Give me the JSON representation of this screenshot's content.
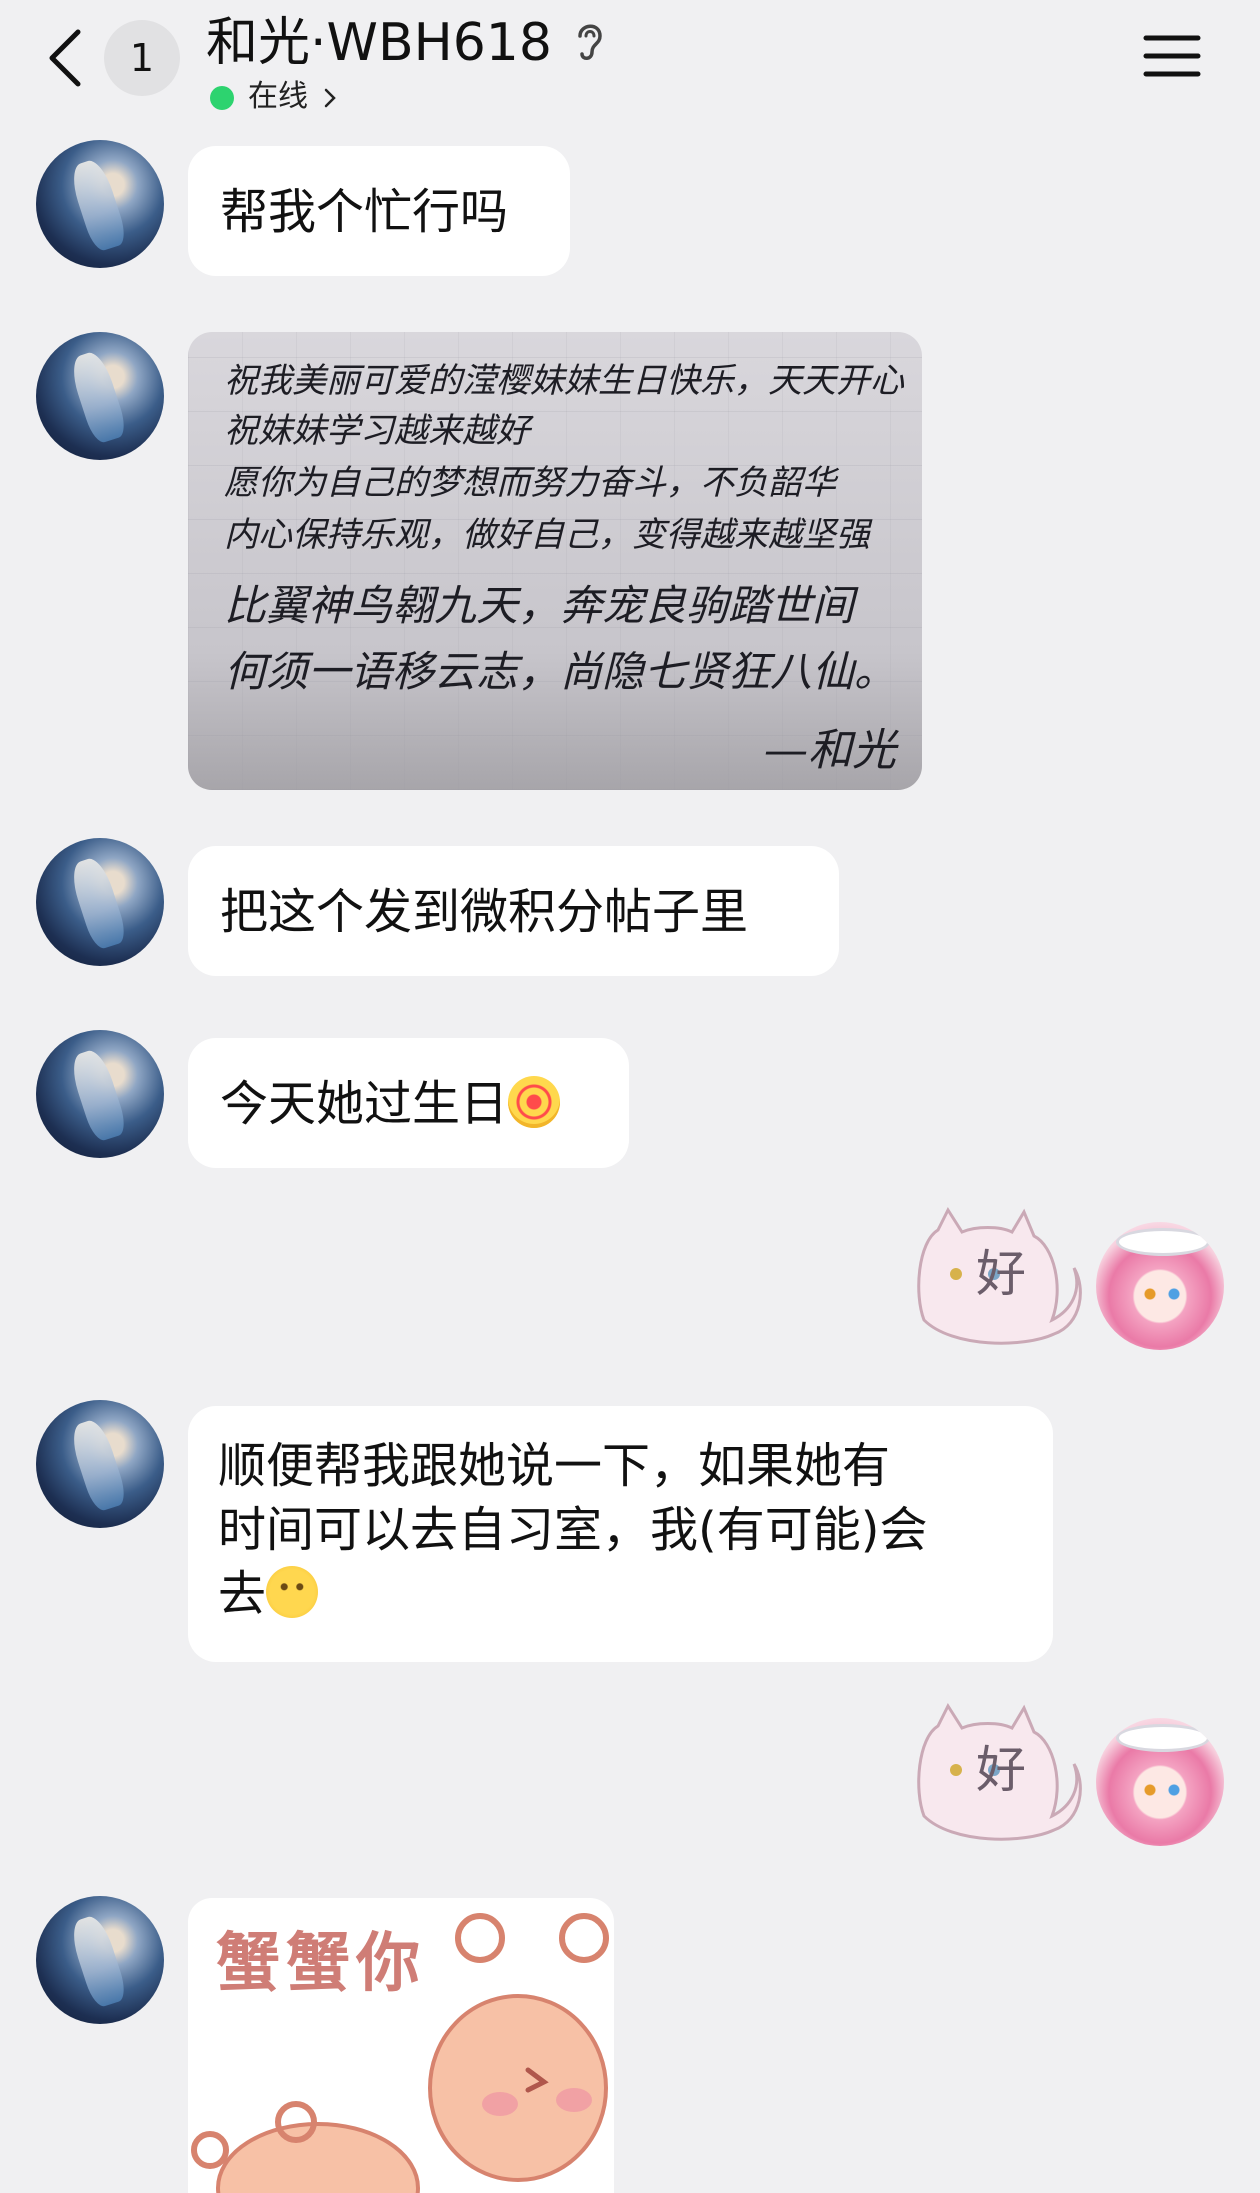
{
  "header": {
    "unread_count": "1",
    "title": "和光·WBH618",
    "status": "在线"
  },
  "messages": [
    {
      "side": "left",
      "type": "text",
      "text": "帮我个忙行吗"
    },
    {
      "side": "left",
      "type": "image",
      "note_lines": [
        "祝我美丽可爱的滢樱妹妹生日快乐，天天开心",
        "祝妹妹学习越来越好",
        "愿你为自己的梦想而努力奋斗，不负韶华",
        "内心保持乐观，做好自己，变得越来越坚强",
        "比翼神鸟翱九天，奔宠良驹踏世间",
        "何须一语移云志，尚隐七贤狂八仙。"
      ],
      "signature": "—和光"
    },
    {
      "side": "left",
      "type": "text",
      "text": "把这个发到微积分帖子里"
    },
    {
      "side": "left",
      "type": "text",
      "text": "今天她过生日",
      "emoji": "dizzy-face-icon"
    },
    {
      "side": "right",
      "type": "sticker",
      "text": "好"
    },
    {
      "side": "left",
      "type": "text",
      "lines": [
        "顺便帮我跟她说一下，如果她有",
        "时间可以去自习室，我(有可能)会",
        "去"
      ],
      "emoji": "smile-icon"
    },
    {
      "side": "right",
      "type": "sticker",
      "text": "好"
    },
    {
      "side": "left",
      "type": "sticker",
      "text": "蟹蟹你"
    }
  ]
}
